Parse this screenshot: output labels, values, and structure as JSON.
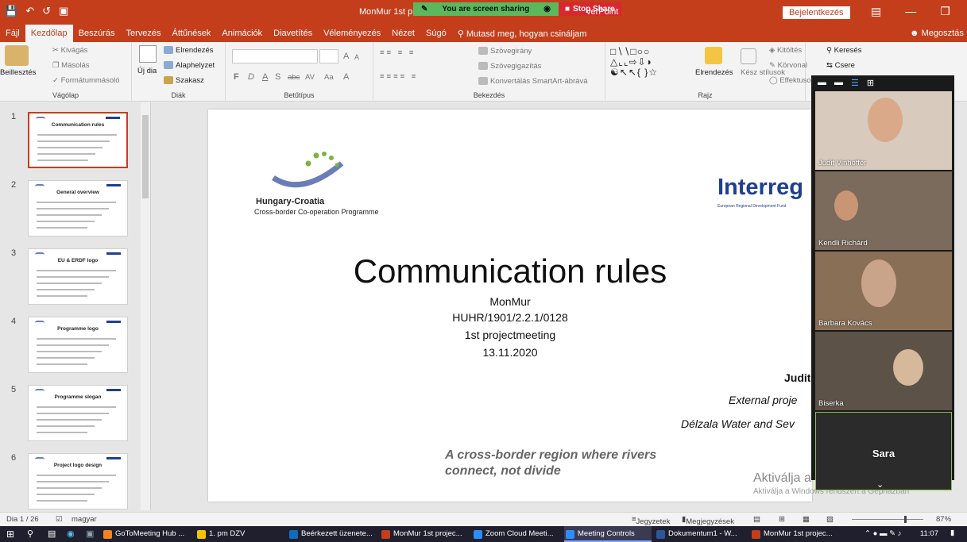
{
  "titlebar": {
    "doc_title_left": "MonMur 1st pr",
    "doc_title_right": "verPoint",
    "share_banner": "You are screen sharing",
    "stop_share": "Stop Share",
    "login": "Bejelentkezés"
  },
  "tabs": [
    "Fájl",
    "Kezdőlap",
    "Beszúrás",
    "Tervezés",
    "Áttűnések",
    "Animációk",
    "Diavetítés",
    "Véleményezés",
    "Nézet",
    "Súgó"
  ],
  "active_tab": "Kezdőlap",
  "tell_me": "Mutasd meg, hogyan csináljam",
  "share": "Megosztás",
  "ribbon": {
    "clipboard": {
      "paste": "Beillesztés",
      "cut": "Kivágás",
      "copy": "Másolás",
      "format_painter": "Formátummásoló",
      "label": "Vágólap"
    },
    "slides": {
      "new_slide": "Új dia",
      "layout": "Elrendezés",
      "reset": "Alaphelyzet",
      "section": "Szakasz",
      "label": "Diák"
    },
    "font": {
      "label": "Betűtípus",
      "bold": "F",
      "italic": "D",
      "underline": "A",
      "shadow": "S",
      "strike": "abc",
      "spacing": "AV",
      "case": "Aa",
      "grow": "A",
      "shrink": "A"
    },
    "paragraph": {
      "text_direction": "Szövegirány",
      "align_text": "Szövegigazítás",
      "smartart": "Konvertálás SmartArt-ábrává",
      "label": "Bekezdés"
    },
    "drawing": {
      "arrange": "Elrendezés",
      "quick_styles": "Kész stílusok",
      "fill": "Kitöltés",
      "outline": "Körvonal",
      "effects": "Effektusok",
      "label": "Rajz"
    },
    "editing": {
      "find": "Keresés",
      "replace": "Csere"
    }
  },
  "thumbnails": [
    {
      "num": "1",
      "title": "Communication rules"
    },
    {
      "num": "2",
      "title": "General overview"
    },
    {
      "num": "3",
      "title": "EU & ERDF logo"
    },
    {
      "num": "4",
      "title": "Programme logo"
    },
    {
      "num": "5",
      "title": "Programme slogan"
    },
    {
      "num": "6",
      "title": "Project logo design"
    }
  ],
  "slide": {
    "program_name": "Hungary-Croatia",
    "program_sub": "Cross-border Co-operation Programme",
    "interreg": "Interreg",
    "erdf": "European Regional Development Fund",
    "title": "Communication rules",
    "project": "MonMur",
    "code": "HUHR/1901/2.2.1/0128",
    "meeting": "1st projectmeeting",
    "date": "13.11.2020",
    "presenter": "Judit",
    "role": "External proje",
    "org": "Délzala Water and Sev",
    "tagline1": "A cross-border region where rivers",
    "tagline2": "connect, not divide"
  },
  "activation": {
    "line1": "Aktiválja a Windowst",
    "line2": "Aktiválja a Windows rendszert a Gépházban"
  },
  "zoom": {
    "participants": [
      "Judit Vinhoffer",
      "Kendli Richárd",
      "Barbara Kovács",
      "Biserka",
      "Sara"
    ]
  },
  "statusbar": {
    "slide": "Dia 1 / 26",
    "language": "magyar",
    "notes": "Jegyzetek",
    "comments": "Megjegyzések",
    "zoom": "87%"
  },
  "taskbar": {
    "items": [
      {
        "label": "GoToMeeting Hub ...",
        "color": "#f58220"
      },
      {
        "label": "1. pm DZV",
        "color": "#f5c400"
      },
      {
        "label": "Beérkezett üzenete...",
        "color": "#0f6cbd"
      },
      {
        "label": "MonMur 1st projec...",
        "color": "#c43e1c"
      },
      {
        "label": "Zoom Cloud Meeti...",
        "color": "#2d8cff"
      },
      {
        "label": "Meeting Controls",
        "color": "#2d8cff"
      },
      {
        "label": "Dokumentum1 - W...",
        "color": "#2b579a"
      },
      {
        "label": "MonMur 1st projec...",
        "color": "#c43e1c"
      }
    ],
    "clock": "11:07"
  },
  "colors": {
    "accent": "#c43e1c",
    "interreg": "#1f3f8f",
    "zoom_bg": "#1a1a1a"
  }
}
